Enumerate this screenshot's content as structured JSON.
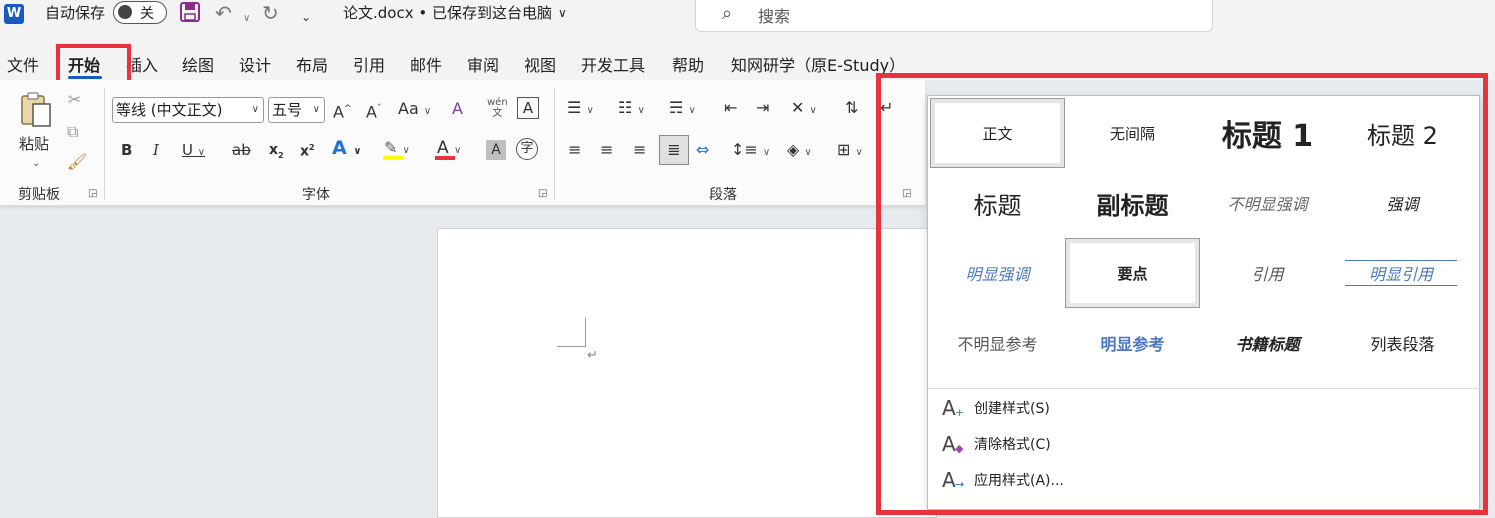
{
  "titlebar": {
    "app_icon": "word-icon",
    "autosave_label": "自动保存",
    "autosave_state": "关",
    "doc_title": "论文.docx • 已保存到这台电脑",
    "title_chevron": "∨",
    "search_placeholder": "搜索"
  },
  "menu": {
    "tabs": [
      "文件",
      "开始",
      "插入",
      "绘图",
      "设计",
      "布局",
      "引用",
      "邮件",
      "审阅",
      "视图",
      "开发工具",
      "帮助",
      "知网研学（原E-Study）"
    ],
    "active_tab": "开始"
  },
  "ribbon": {
    "clipboard": {
      "group_label": "剪贴板",
      "paste_label": "粘贴"
    },
    "font": {
      "group_label": "字体",
      "font_name": "等线 (中文正文)",
      "font_size": "五号",
      "highlight_color": "#ffff00",
      "font_color": "#e8333c"
    },
    "paragraph": {
      "group_label": "段落"
    }
  },
  "document": {
    "paragraph_mark": "↵"
  },
  "styles_gallery": {
    "styles": [
      {
        "label": "正文",
        "selected": true
      },
      {
        "label": "无间隔",
        "selected": false
      },
      {
        "label": "标题 1",
        "selected": false
      },
      {
        "label": "标题 2",
        "selected": false
      },
      {
        "label": "标题",
        "selected": false
      },
      {
        "label": "副标题",
        "selected": false
      },
      {
        "label": "不明显强调",
        "selected": false
      },
      {
        "label": "强调",
        "selected": false
      },
      {
        "label": "明显强调",
        "selected": false
      },
      {
        "label": "要点",
        "selected": true
      },
      {
        "label": "引用",
        "selected": false
      },
      {
        "label": "明显引用",
        "selected": false
      },
      {
        "label": "不明显参考",
        "selected": false
      },
      {
        "label": "明显参考",
        "selected": false
      },
      {
        "label": "书籍标题",
        "selected": false
      },
      {
        "label": "列表段落",
        "selected": false
      }
    ],
    "commands": [
      {
        "label": "创建样式(S)",
        "icon": "create-style-icon"
      },
      {
        "label": "清除格式(C)",
        "icon": "clear-formatting-icon"
      },
      {
        "label": "应用样式(A)...",
        "icon": "apply-styles-icon"
      }
    ]
  },
  "highlight_color": "#e8333c",
  "accent_color": "#185abd"
}
